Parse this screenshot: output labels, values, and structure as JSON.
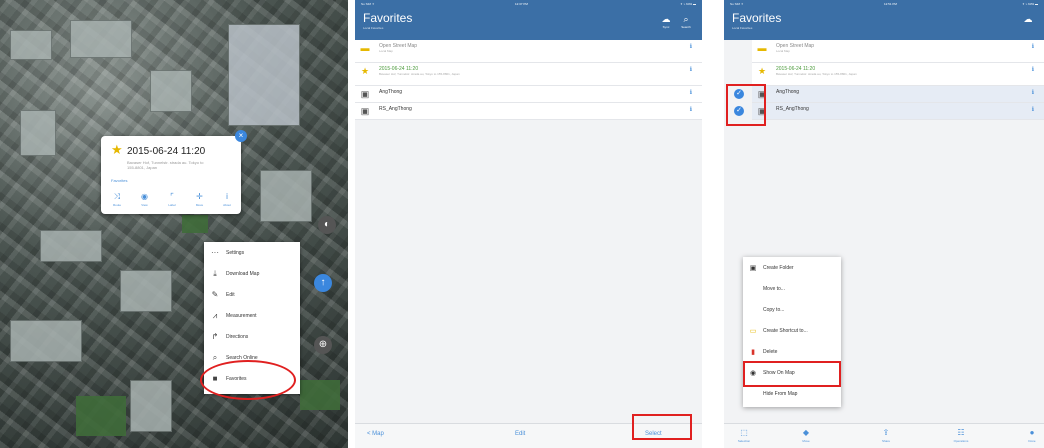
{
  "panel1": {
    "popup": {
      "title": "2015-06-24 11:20",
      "address": "Bavaser Hof, Tunnelstr. strada au. Tokyo to 155-8801, Japan",
      "favorite_label": "Favorites",
      "actions": [
        {
          "icon": "route-icon",
          "glyph": "⤨",
          "label": "Route"
        },
        {
          "icon": "view-icon",
          "glyph": "◉",
          "label": "View"
        },
        {
          "icon": "label-icon",
          "glyph": "⌜",
          "label": "Label"
        },
        {
          "icon": "move-icon",
          "glyph": "✛",
          "label": "Move"
        },
        {
          "icon": "info-icon",
          "glyph": "i",
          "label": "About"
        }
      ],
      "close_glyph": "×"
    },
    "menu": [
      {
        "icon": "more-icon",
        "glyph": "···",
        "label": "Settings"
      },
      {
        "icon": "download-icon",
        "glyph": "⤓",
        "label": "Download Map"
      },
      {
        "icon": "edit-icon",
        "glyph": "✎",
        "label": "Edit"
      },
      {
        "icon": "measurement-icon",
        "glyph": "⩘",
        "label": "Measurement"
      },
      {
        "icon": "directions-icon",
        "glyph": "↱",
        "label": "Directions"
      },
      {
        "icon": "search-icon",
        "glyph": "⌕",
        "label": "Search Online"
      },
      {
        "icon": "favorites-icon",
        "glyph": "■",
        "label": "Favorites"
      }
    ]
  },
  "panel2": {
    "status_left": "No SIM ✦",
    "clock": "12:37 PM",
    "battery": "✦ ⌁ 64% ▬",
    "title": "Favorites",
    "subtitle": "Local Favorites",
    "nav_icons": [
      {
        "icon": "cloud-icon",
        "glyph": "☁",
        "label": "Sync"
      },
      {
        "icon": "search-icon",
        "glyph": "⌕",
        "label": "Search"
      }
    ],
    "rows": [
      {
        "icon": "map-folder-icon",
        "glyph": "▬",
        "title": "Open Street Map",
        "sub": "Local Map"
      },
      {
        "icon": "star-icon",
        "glyph": "★",
        "title": "2015-06-24 11:20",
        "sub": "Bavaser Hof, Tunnelstr. strada au, Tokyo to 155-8801, Japan"
      },
      {
        "icon": "folder-icon",
        "glyph": "▣",
        "title": "AngThong",
        "sub": ""
      },
      {
        "icon": "folder-icon",
        "glyph": "▣",
        "title": "RS_AngThong",
        "sub": ""
      }
    ],
    "chevron": "ℹ",
    "toolbar": {
      "back": "< Map",
      "edit": "Edit",
      "select": "Select"
    }
  },
  "panel3": {
    "status_left": "No SIM ✦",
    "clock": "12:51 PM",
    "battery": "✦ ⌁ 63% ▬",
    "title": "Favorites",
    "subtitle": "Local Favorites",
    "menu": [
      {
        "icon": "folder-icon",
        "glyph": "▣",
        "label": "Create Folder"
      },
      {
        "icon": "",
        "glyph": "",
        "label": "Move to..."
      },
      {
        "icon": "",
        "glyph": "",
        "label": "Copy to..."
      },
      {
        "icon": "shortcut-icon",
        "glyph": "▭",
        "label": "Create Shortcut to..."
      },
      {
        "icon": "trash-icon",
        "glyph": "▮",
        "label": "Delete"
      },
      {
        "icon": "eye-icon",
        "glyph": "◉",
        "label": "Show On Map"
      },
      {
        "icon": "",
        "glyph": "",
        "label": "Hide From Map"
      }
    ],
    "toolbar": [
      {
        "icon": "selection-icon",
        "glyph": "⬚",
        "label": "Selection"
      },
      {
        "icon": "move-icon",
        "glyph": "◆",
        "label": "Move"
      },
      {
        "icon": "share-icon",
        "glyph": "⇪",
        "label": "Share"
      },
      {
        "icon": "operations-icon",
        "glyph": "☷",
        "label": "Operations"
      },
      {
        "icon": "done-icon",
        "glyph": "●",
        "label": "Done"
      }
    ],
    "check": "✓"
  },
  "colors": {
    "accent": "#3b87de",
    "navbar": "#3b6fa6",
    "highlight": "#e02020"
  }
}
